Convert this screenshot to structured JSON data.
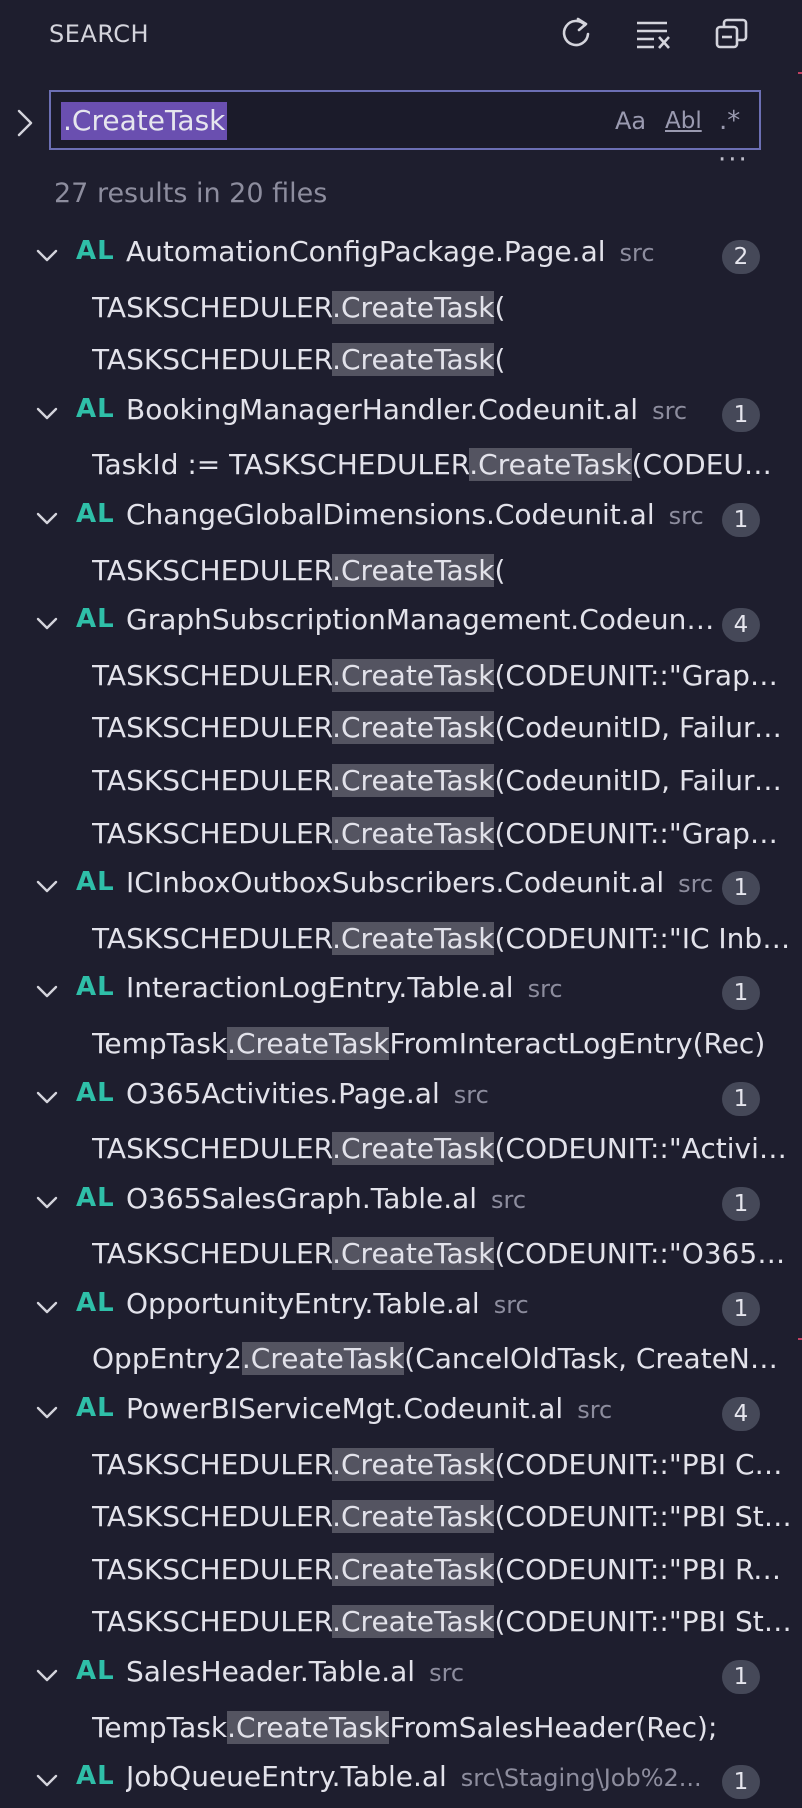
{
  "header": {
    "title": "SEARCH"
  },
  "icons": {
    "refresh": "refresh-icon",
    "clear": "clear-results-icon",
    "collapse": "collapse-all-icon",
    "toggle_replace": "chevron-right-icon",
    "chevron": "chevron-down-icon"
  },
  "search": {
    "value": ".CreateTask",
    "match_case_label": "Aa",
    "whole_word_label": "Abl",
    "regex_label": ".*",
    "more_label": "···"
  },
  "summary": "27 results in 20 files",
  "colors": {
    "accent_border": "#6c6fb4",
    "selection": "#6a4fb0",
    "match_highlight": "#545461",
    "lang_badge": "#2fbfa8"
  },
  "groups": [
    {
      "lang": "AL",
      "file": "AutomationConfigPackage.Page.al",
      "path": "src",
      "count": "2",
      "matches": [
        {
          "pre": "TASKSCHEDULER",
          "match": ".CreateTask",
          "post": "("
        },
        {
          "pre": "TASKSCHEDULER",
          "match": ".CreateTask",
          "post": "("
        }
      ]
    },
    {
      "lang": "AL",
      "file": "BookingManagerHandler.Codeunit.al",
      "path": "src",
      "count": "1",
      "matches": [
        {
          "pre": "TaskId := TASKSCHEDULER",
          "match": ".CreateTask",
          "post": "(CODEUNIT..."
        }
      ]
    },
    {
      "lang": "AL",
      "file": "ChangeGlobalDimensions.Codeunit.al",
      "path": "src",
      "count": "1",
      "matches": [
        {
          "pre": "TASKSCHEDULER",
          "match": ".CreateTask",
          "post": "("
        }
      ]
    },
    {
      "lang": "AL",
      "file": "GraphSubscriptionManagement.Codeunit...",
      "path": "",
      "count": "4",
      "matches": [
        {
          "pre": "TASKSCHEDULER",
          "match": ".CreateTask",
          "post": "(CODEUNIT::\"Graph ..."
        },
        {
          "pre": "TASKSCHEDULER",
          "match": ".CreateTask",
          "post": "(CodeunitID, Failure..."
        },
        {
          "pre": "TASKSCHEDULER",
          "match": ".CreateTask",
          "post": "(CodeunitID, Failure..."
        },
        {
          "pre": "TASKSCHEDULER",
          "match": ".CreateTask",
          "post": "(CODEUNIT::\"Graph ..."
        }
      ]
    },
    {
      "lang": "AL",
      "file": "ICInboxOutboxSubscribers.Codeunit.al",
      "path": "src",
      "count": "1",
      "matches": [
        {
          "pre": "TASKSCHEDULER",
          "match": ".CreateTask",
          "post": "(CODEUNIT::\"IC Inbo..."
        }
      ]
    },
    {
      "lang": "AL",
      "file": "InteractionLogEntry.Table.al",
      "path": "src",
      "count": "1",
      "matches": [
        {
          "pre": "TempTask",
          "match": ".CreateTask",
          "post": "FromInteractLogEntry(Rec)"
        }
      ]
    },
    {
      "lang": "AL",
      "file": "O365Activities.Page.al",
      "path": "src",
      "count": "1",
      "matches": [
        {
          "pre": "TASKSCHEDULER",
          "match": ".CreateTask",
          "post": "(CODEUNIT::\"Activiti..."
        }
      ]
    },
    {
      "lang": "AL",
      "file": "O365SalesGraph.Table.al",
      "path": "src",
      "count": "1",
      "matches": [
        {
          "pre": "TASKSCHEDULER",
          "match": ".CreateTask",
          "post": "(CODEUNIT::\"O365 S..."
        }
      ]
    },
    {
      "lang": "AL",
      "file": "OpportunityEntry.Table.al",
      "path": "src",
      "count": "1",
      "matches": [
        {
          "pre": "OppEntry2",
          "match": ".CreateTask",
          "post": "(CancelOldTask, CreateNew..."
        }
      ]
    },
    {
      "lang": "AL",
      "file": "PowerBIServiceMgt.Codeunit.al",
      "path": "src",
      "count": "4",
      "matches": [
        {
          "pre": "TASKSCHEDULER",
          "match": ".CreateTask",
          "post": "(CODEUNIT::\"PBI Ch..."
        },
        {
          "pre": "TASKSCHEDULER",
          "match": ".CreateTask",
          "post": "(CODEUNIT::\"PBI Sta..."
        },
        {
          "pre": "TASKSCHEDULER",
          "match": ".CreateTask",
          "post": "(CODEUNIT::\"PBI Ret..."
        },
        {
          "pre": "TASKSCHEDULER",
          "match": ".CreateTask",
          "post": "(CODEUNIT::\"PBI Sta..."
        }
      ]
    },
    {
      "lang": "AL",
      "file": "SalesHeader.Table.al",
      "path": "src",
      "count": "1",
      "matches": [
        {
          "pre": "TempTask",
          "match": ".CreateTask",
          "post": "FromSalesHeader(Rec);"
        }
      ]
    },
    {
      "lang": "AL",
      "file": "JobQueueEntry.Table.al",
      "path": "src\\Staging\\Job%2...",
      "count": "1",
      "matches": []
    }
  ]
}
